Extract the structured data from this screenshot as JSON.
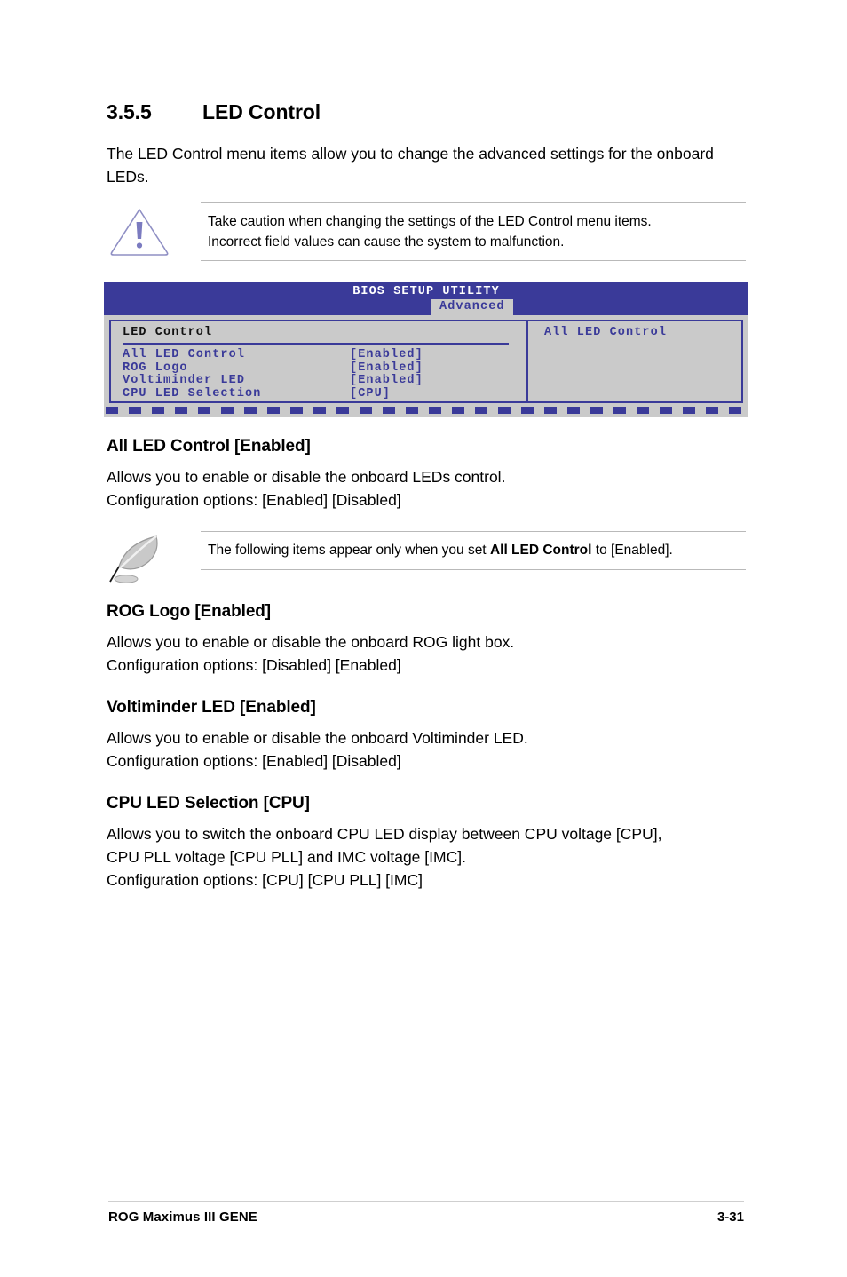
{
  "section": {
    "number": "3.5.5",
    "title": "LED Control",
    "intro": "The LED Control menu items allow you to change the advanced settings for the onboard LEDs."
  },
  "warning_callout": {
    "icon": "warning-triangle-icon",
    "line1": "Take caution when changing the settings of the LED Control menu items.",
    "line2": "Incorrect field values can cause the system to malfunction."
  },
  "bios": {
    "title": "BIOS SETUP UTILITY",
    "tab": "Advanced",
    "group_title": "LED Control",
    "items": [
      {
        "label": "All LED Control",
        "value": "[Enabled]"
      },
      {
        "label": "ROG Logo",
        "value": "[Enabled]"
      },
      {
        "label": "Voltiminder LED",
        "value": "[Enabled]"
      },
      {
        "label": "CPU LED Selection",
        "value": "[CPU]"
      }
    ],
    "help_title": "All LED Control",
    "colors": {
      "chrome": "#3a3a99",
      "panel": "#cacaca",
      "title_text": "#ffffff"
    }
  },
  "note_callout": {
    "icon": "quill-pen-icon",
    "text_before": "The following items appear only when you set ",
    "text_bold": "All LED Control",
    "text_after": " to [Enabled]."
  },
  "subsections": [
    {
      "title": "All LED Control [Enabled]",
      "lines": [
        "Allows you to enable or disable the onboard LEDs control.",
        "Configuration options: [Enabled] [Disabled]"
      ]
    },
    {
      "title": "ROG Logo [Enabled]",
      "lines": [
        "Allows you to enable or disable the onboard ROG light box.",
        "Configuration options: [Disabled] [Enabled]"
      ]
    },
    {
      "title": "Voltiminder LED [Enabled]",
      "lines": [
        "Allows you to enable or disable the onboard Voltiminder LED.",
        "Configuration options: [Enabled] [Disabled]"
      ]
    },
    {
      "title": "CPU LED Selection [CPU]",
      "lines": [
        "Allows you to switch the onboard CPU LED display between CPU voltage [CPU],",
        "CPU PLL voltage [CPU PLL] and IMC voltage [IMC].",
        "Configuration options: [CPU] [CPU PLL] [IMC]"
      ]
    }
  ],
  "footer": {
    "left": "ROG Maximus III GENE",
    "right": "3-31"
  }
}
